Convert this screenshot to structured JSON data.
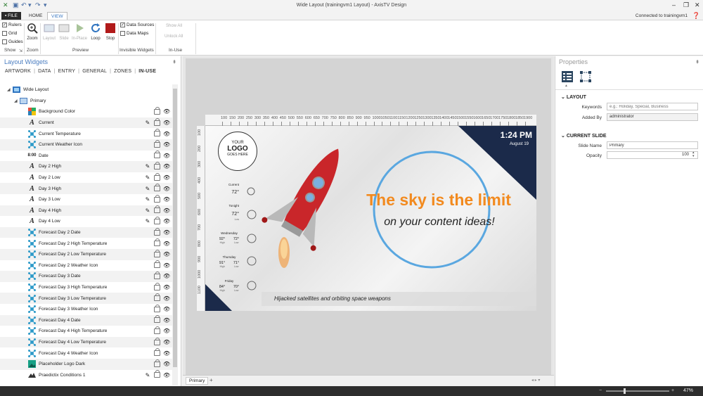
{
  "window": {
    "title": "Wide Layout (trainingvm1 Layout) - AxisTV Design",
    "minimize": "–",
    "restore": "❐",
    "close": "✕"
  },
  "quick_access": {
    "undo": "↶",
    "redo": "↷",
    "more": "▾"
  },
  "tabs": {
    "file": "▪ FILE",
    "home": "HOME",
    "view": "VIEW"
  },
  "connected": "Connected to trainingvm1",
  "ribbon": {
    "show": {
      "rulers": "Rulers",
      "grid": "Grid",
      "guides": "Guides",
      "label": "Show"
    },
    "zoom": {
      "button": "Zoom",
      "label": "Zoom"
    },
    "preview": {
      "layout": "Layout",
      "slide": "Slide",
      "inplace": "In-Place",
      "loop": "Loop",
      "stop": "Stop",
      "label": "Preview"
    },
    "invisible": {
      "data_sources": "Data Sources",
      "data_maps": "Data Maps",
      "label": "Invisible Widgets"
    },
    "inuse": {
      "show_all": "Show All",
      "unlock_all": "Unlock All",
      "label": "In-Use"
    }
  },
  "left_panel": {
    "title": "Layout Widgets",
    "tabs": [
      "ARTWORK",
      "DATA",
      "ENTRY",
      "GENERAL",
      "ZONES",
      "IN-USE"
    ],
    "separator": "|",
    "tree": [
      {
        "label": "Wide Layout",
        "icon": "layout",
        "level": 0
      },
      {
        "label": "Primary",
        "icon": "slide",
        "level": 1
      },
      {
        "label": "Background Color",
        "icon": "color",
        "level": 2,
        "pen": false
      },
      {
        "label": "Current",
        "icon": "text",
        "level": 2,
        "pen": true
      },
      {
        "label": "Current Temperature",
        "icon": "data",
        "level": 2,
        "pen": false
      },
      {
        "label": "Current Weather Icon",
        "icon": "data",
        "level": 2,
        "pen": false
      },
      {
        "label": "Date",
        "icon": "clock",
        "level": 2,
        "pen": false
      },
      {
        "label": "Day 2 High",
        "icon": "text",
        "level": 2,
        "pen": true
      },
      {
        "label": "Day 2 Low",
        "icon": "text",
        "level": 2,
        "pen": true
      },
      {
        "label": "Day 3 High",
        "icon": "text",
        "level": 2,
        "pen": true
      },
      {
        "label": "Day 3 Low",
        "icon": "text",
        "level": 2,
        "pen": true
      },
      {
        "label": "Day 4 High",
        "icon": "text",
        "level": 2,
        "pen": true
      },
      {
        "label": "Day 4 Low",
        "icon": "text",
        "level": 2,
        "pen": true
      },
      {
        "label": "Forecast Day 2 Date",
        "icon": "data",
        "level": 2,
        "pen": false
      },
      {
        "label": "Forecast Day 2 High Temperature",
        "icon": "data",
        "level": 2,
        "pen": false
      },
      {
        "label": "Forecast Day 2 Low Temperature",
        "icon": "data",
        "level": 2,
        "pen": false
      },
      {
        "label": "Forecast Day 2 Weather Icon",
        "icon": "data",
        "level": 2,
        "pen": false
      },
      {
        "label": "Forecast Day 3 Date",
        "icon": "data",
        "level": 2,
        "pen": false
      },
      {
        "label": "Forecast Day 3 High Temperature",
        "icon": "data",
        "level": 2,
        "pen": false
      },
      {
        "label": "Forecast Day 3 Low Temperature",
        "icon": "data",
        "level": 2,
        "pen": false
      },
      {
        "label": "Forecast Day 3 Weather Icon",
        "icon": "data",
        "level": 2,
        "pen": false
      },
      {
        "label": "Forecast Day 4 Date",
        "icon": "data",
        "level": 2,
        "pen": false
      },
      {
        "label": "Forecast Day 4 High Temperature",
        "icon": "data",
        "level": 2,
        "pen": false
      },
      {
        "label": "Forecast Day 4 Low Temperature",
        "icon": "data",
        "level": 2,
        "pen": false
      },
      {
        "label": "Forecast Day 4 Weather Icon",
        "icon": "data",
        "level": 2,
        "pen": false
      },
      {
        "label": "Placeholder Logo Dark",
        "icon": "image",
        "level": 2,
        "pen": false
      },
      {
        "label": "Praedictix Conditions 1",
        "icon": "weather",
        "level": 2,
        "pen": true
      }
    ]
  },
  "rulers": {
    "top": [
      "100",
      "150",
      "200",
      "250",
      "300",
      "350",
      "400",
      "450",
      "500",
      "550",
      "600",
      "650",
      "700",
      "750",
      "800",
      "850",
      "900",
      "950",
      "1000",
      "1050",
      "1100",
      "1150",
      "1200",
      "1250",
      "1300",
      "1350",
      "1400",
      "1450",
      "1500",
      "1550",
      "1600",
      "1650",
      "1700",
      "1750",
      "1800",
      "1850",
      "1900"
    ],
    "left": [
      "100",
      "200",
      "300",
      "400",
      "500",
      "600",
      "700",
      "800",
      "900",
      "1000",
      "1100"
    ]
  },
  "slide": {
    "logo": {
      "line1": "YOUR",
      "line2": "LOGO",
      "line3": "GOES HERE"
    },
    "time": "1:24 PM",
    "date": "August 19",
    "headline": "The sky is the limit",
    "subhead": "on your content ideas!",
    "ticker": "Hijacked satellites and orbiting space weapons",
    "weather": {
      "current_label": "Current",
      "current_temp": "72°",
      "tonight_label": "Tonight",
      "tonight_temp": "72°",
      "tonight_low": "Low",
      "days": [
        {
          "name": "Wednesday",
          "high": "92°",
          "low": "72°",
          "high_label": "High",
          "low_label": "Low"
        },
        {
          "name": "Thursday",
          "high": "91°",
          "low": "71°",
          "high_label": "High",
          "low_label": "Low"
        },
        {
          "name": "Friday",
          "high": "84°",
          "low": "70°",
          "high_label": "High",
          "low_label": "Low"
        }
      ]
    }
  },
  "bottom_tabs": {
    "primary": "Primary",
    "add": "+"
  },
  "properties": {
    "title": "Properties",
    "layout_section": "LAYOUT",
    "keywords_label": "Keywords",
    "keywords_placeholder": "e.g.: Holiday, Special, Business",
    "added_by_label": "Added By",
    "added_by": "administrator",
    "slide_section": "CURRENT SLIDE",
    "slide_name_label": "Slide Name",
    "slide_name": "Primary",
    "opacity_label": "Opacity",
    "opacity": "100"
  },
  "status": {
    "zoom": "47%",
    "zoom_level": 0.47
  },
  "colors": {
    "accent": "#3a78c2",
    "orange": "#f28a1f",
    "navy": "#1b2a4a",
    "stop_red": "#b11a1a"
  }
}
